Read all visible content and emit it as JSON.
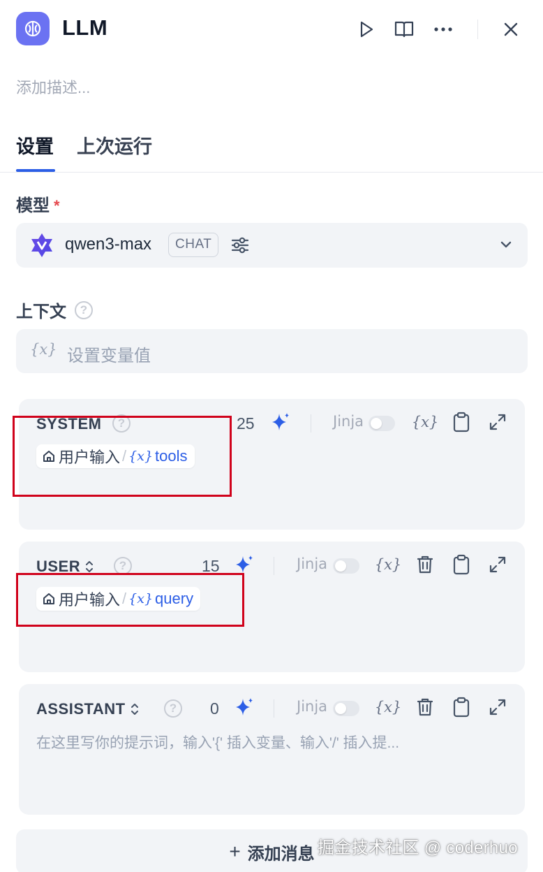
{
  "header": {
    "title": "LLM",
    "description_placeholder": "添加描述...",
    "icons": [
      "brain-icon",
      "play-icon",
      "book-icon",
      "more-icon",
      "close-icon"
    ]
  },
  "tabs": [
    {
      "label": "设置",
      "active": true
    },
    {
      "label": "上次运行",
      "active": false
    }
  ],
  "model_section": {
    "label": "模型",
    "required_mark": "*",
    "model_name": "qwen3-max",
    "mode_badge": "CHAT"
  },
  "context_section": {
    "label": "上下文",
    "var_symbol": "{x}",
    "placeholder": "设置变量值"
  },
  "messages": [
    {
      "role": "SYSTEM",
      "count": "25",
      "jinja_label": "Jinja",
      "var_symbol": "{x}",
      "variable": {
        "source": "用户输入",
        "slash": "/",
        "x": "{x}",
        "name": "tools"
      }
    },
    {
      "role": "USER",
      "count": "15",
      "jinja_label": "Jinja",
      "var_symbol": "{x}",
      "variable": {
        "source": "用户输入",
        "slash": "/",
        "x": "{x}",
        "name": "query"
      }
    },
    {
      "role": "ASSISTANT",
      "count": "0",
      "jinja_label": "Jinja",
      "var_symbol": "{x}",
      "placeholder": "在这里写你的提示词，输入'{' 插入变量、输入'/' 插入提..."
    }
  ],
  "add_message": {
    "plus": "+",
    "label": "添加消息"
  },
  "watermark": "掘金技术社区 @ coderhuo",
  "colors": {
    "accent": "#2c5ee6",
    "app_icon": "#6b72f2",
    "highlight_box": "#d0021b",
    "required": "#e5484d"
  }
}
